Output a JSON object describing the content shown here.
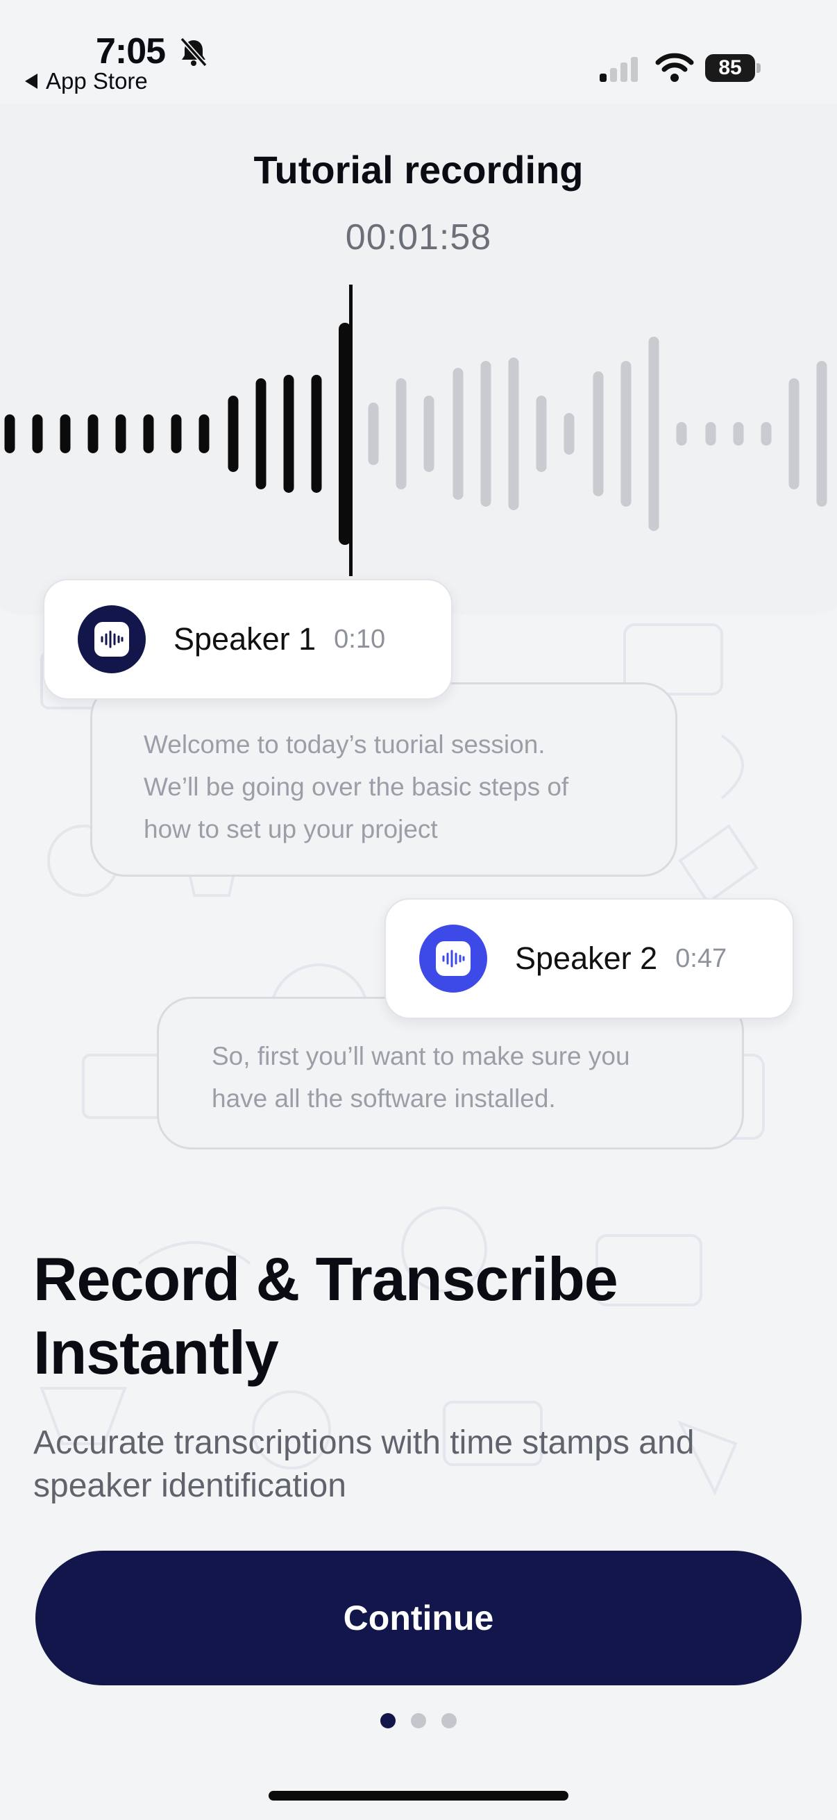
{
  "status_bar": {
    "time": "7:05",
    "back_label": "App Store",
    "battery": "85",
    "icons": [
      "bell-slash-icon",
      "signal-icon",
      "wifi-icon",
      "battery-icon"
    ]
  },
  "recording": {
    "title": "Tutorial recording",
    "elapsed": "00:01:58",
    "played_color": "#0b0b0b",
    "unplayed_color": "#c9cbd1"
  },
  "transcript": [
    {
      "speaker": "Speaker 1",
      "timestamp": "0:10",
      "avatar_color": "#13164a",
      "lines": [
        "Welcome to today’s tuorial session.",
        "We’ll be going over the basic steps of",
        "how to set up your project"
      ]
    },
    {
      "speaker": "Speaker 2",
      "timestamp": "0:47",
      "avatar_color": "#3d4ae8",
      "lines": [
        "So, first you’ll want to make sure you",
        "have all the software installed."
      ]
    }
  ],
  "onboarding": {
    "headline_line1": "Record & Transcribe",
    "headline_line2": "Instantly",
    "subtitle_line1": "Accurate transcriptions with time stamps and",
    "subtitle_line2": "speaker identification",
    "continue_label": "Continue",
    "page_count": 3,
    "active_page": 1,
    "accent": "#13164a"
  }
}
